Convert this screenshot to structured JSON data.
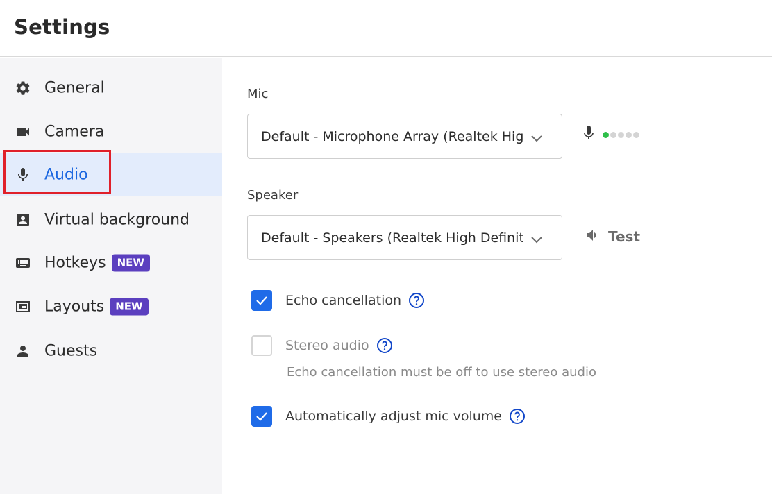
{
  "header": {
    "title": "Settings"
  },
  "sidebar": {
    "items": [
      {
        "label": "General",
        "icon": "gear-icon"
      },
      {
        "label": "Camera",
        "icon": "video-camera-icon"
      },
      {
        "label": "Audio",
        "icon": "microphone-icon",
        "active": true
      },
      {
        "label": "Virtual background",
        "icon": "portrait-icon"
      },
      {
        "label": "Hotkeys",
        "icon": "keyboard-icon",
        "badge": "NEW"
      },
      {
        "label": "Layouts",
        "icon": "layout-icon",
        "badge": "NEW"
      },
      {
        "label": "Guests",
        "icon": "person-icon"
      }
    ]
  },
  "audio": {
    "mic": {
      "label": "Mic",
      "selected": "Default - Microphone Array (Realtek High Definition Audio)",
      "level_dots_total": 5,
      "level_dots_active": 1
    },
    "speaker": {
      "label": "Speaker",
      "selected": "Default - Speakers (Realtek High Definition Audio)",
      "test_label": "Test"
    },
    "options": {
      "echo_cancellation": {
        "label": "Echo cancellation",
        "checked": true
      },
      "stereo_audio": {
        "label": "Stereo audio",
        "checked": false,
        "disabled": true,
        "hint": "Echo cancellation must be off to use stereo audio"
      },
      "auto_adjust": {
        "label": "Automatically adjust mic volume",
        "checked": true
      }
    }
  },
  "colors": {
    "accent": "#1f6be8",
    "active_nav_bg": "#e3ecfc",
    "active_nav_text": "#1a66e0",
    "badge": "#5b3fbf",
    "highlight": "#e0202a",
    "meter_on": "#2fbf4a"
  }
}
